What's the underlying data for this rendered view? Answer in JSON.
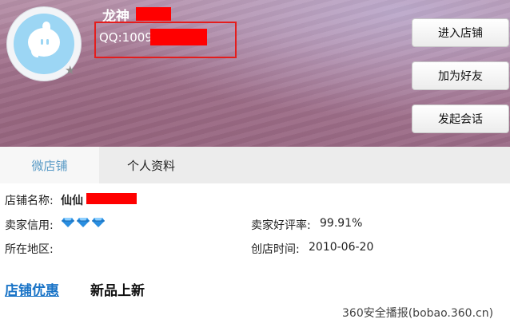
{
  "profile": {
    "nickname": "龙神",
    "qq_label": "QQ:1009",
    "avatar_icon": "qq-bubble-avatar-icon",
    "badge_icon": "star-icon"
  },
  "actions": {
    "enter_shop": "进入店铺",
    "add_friend": "加为好友",
    "start_chat": "发起会话"
  },
  "tabs": [
    {
      "label": "微店铺",
      "active": true
    },
    {
      "label": "个人资料",
      "active": false
    }
  ],
  "shop_info": {
    "name_label": "店铺名称:",
    "name_value": "仙仙",
    "credit_label": "卖家信用:",
    "credit_diamonds": 3,
    "credit_icon": "diamond-icon",
    "rating_label": "卖家好评率:",
    "rating_value": "99.91%",
    "region_label": "所在地区:",
    "region_value": "",
    "opened_label": "创店时间:",
    "opened_value": "2010-06-20"
  },
  "sections": {
    "promotions": "店铺优惠",
    "new_arrivals": "新品上新"
  },
  "watermark": "360安全播报(bobao.360.cn)",
  "colors": {
    "accent_tab": "#5a9bc6",
    "link": "#1a74c7",
    "redaction": "#ff0000",
    "highlight_box": "#e41d1d",
    "diamond": "#2a8ee0"
  }
}
